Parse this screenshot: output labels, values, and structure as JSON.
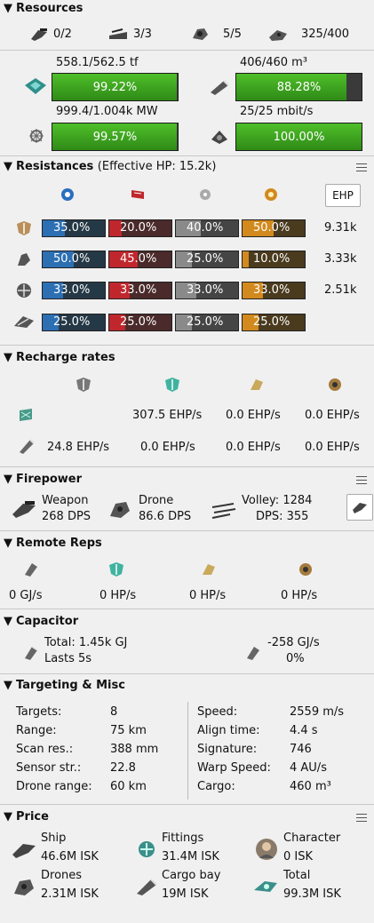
{
  "resources": {
    "header": "Resources",
    "hardpoints": [
      {
        "icon": "turret-hardpoint-icon",
        "value": "0/2"
      },
      {
        "icon": "launcher-hardpoint-icon",
        "value": "3/3"
      },
      {
        "icon": "drone-bandwidth-icon",
        "value": "5/5"
      },
      {
        "icon": "calibration-icon",
        "value": "325/400"
      }
    ],
    "cpu": {
      "label": "558.1/562.5 tf",
      "percent_text": "99.22%",
      "fraction": 0.9922
    },
    "cargo": {
      "label": "406/460 m³",
      "percent_text": "88.28%",
      "fraction": 0.8828
    },
    "power": {
      "label": "999.4/1.004k MW",
      "percent_text": "99.57%",
      "fraction": 0.9957
    },
    "drone_bw": {
      "label": "25/25 mbit/s",
      "percent_text": "100.00%",
      "fraction": 1.0
    }
  },
  "resistances": {
    "header": "Resistances",
    "effective_hp": "(Effective HP: 15.2k)",
    "ehp_button": "EHP",
    "columns": [
      "em-icon",
      "thermal-icon",
      "kinetic-icon",
      "explosive-icon"
    ],
    "colors": [
      "#2c6fb3",
      "#c0272d",
      "#8a8a8a",
      "#d28a1e"
    ],
    "dark_colors": [
      "#253846",
      "#4a2a2a",
      "#454545",
      "#4a3a1e"
    ],
    "rows": [
      {
        "name": "shield",
        "values": [
          "35.0%",
          "20.0%",
          "40.0%",
          "50.0%"
        ],
        "fractions": [
          0.35,
          0.2,
          0.4,
          0.5
        ],
        "ehp": "9.31k"
      },
      {
        "name": "armor",
        "values": [
          "50.0%",
          "45.0%",
          "25.0%",
          "10.0%"
        ],
        "fractions": [
          0.5,
          0.45,
          0.25,
          0.1
        ],
        "ehp": "3.33k"
      },
      {
        "name": "hull",
        "values": [
          "33.0%",
          "33.0%",
          "33.0%",
          "33.0%"
        ],
        "fractions": [
          0.33,
          0.33,
          0.33,
          0.33
        ],
        "ehp": "2.51k"
      },
      {
        "name": "damage-pattern",
        "values": [
          "25.0%",
          "25.0%",
          "25.0%",
          "25.0%"
        ],
        "fractions": [
          0.25,
          0.25,
          0.25,
          0.25
        ],
        "ehp": ""
      }
    ]
  },
  "recharge": {
    "header": "Recharge rates",
    "row1": [
      "307.5 EHP/s",
      "0.0 EHP/s",
      "0.0 EHP/s"
    ],
    "row2": [
      "24.8 EHP/s",
      "0.0 EHP/s",
      "0.0 EHP/s",
      "0.0 EHP/s"
    ]
  },
  "firepower": {
    "header": "Firepower",
    "weapon_label": "Weapon",
    "weapon_dps": "268 DPS",
    "drone_label": "Drone",
    "drone_dps": "86.6 DPS",
    "volley": "Volley: 1284",
    "dps": "DPS: 355"
  },
  "remote_reps": {
    "header": "Remote Reps",
    "values": [
      "0 GJ/s",
      "0 HP/s",
      "0 HP/s",
      "0 HP/s"
    ]
  },
  "capacitor": {
    "header": "Capacitor",
    "total": "Total: 1.45k GJ",
    "lasts": "Lasts 5s",
    "delta": "-258 GJ/s",
    "percent": "0%"
  },
  "targeting": {
    "header": "Targeting & Misc",
    "left": [
      {
        "label": "Targets:",
        "value": "8"
      },
      {
        "label": "Range:",
        "value": "75 km"
      },
      {
        "label": "Scan res.:",
        "value": "388 mm"
      },
      {
        "label": "Sensor str.:",
        "value": "22.8"
      },
      {
        "label": "Drone range:",
        "value": "60 km"
      }
    ],
    "right": [
      {
        "label": "Speed:",
        "value": "2559 m/s"
      },
      {
        "label": "Align time:",
        "value": "4.4 s"
      },
      {
        "label": "Signature:",
        "value": "746"
      },
      {
        "label": "Warp Speed:",
        "value": "4 AU/s"
      },
      {
        "label": "Cargo:",
        "value": "460 m³"
      }
    ]
  },
  "price": {
    "header": "Price",
    "items": [
      {
        "label": "Ship",
        "value": "46.6M ISK"
      },
      {
        "label": "Fittings",
        "value": "31.4M ISK"
      },
      {
        "label": "Character",
        "value": "0 ISK"
      },
      {
        "label": "Drones",
        "value": "2.31M ISK"
      },
      {
        "label": "Cargo bay",
        "value": "19M ISK"
      },
      {
        "label": "Total",
        "value": "99.3M ISK"
      }
    ]
  }
}
